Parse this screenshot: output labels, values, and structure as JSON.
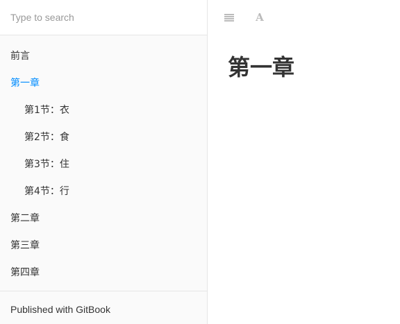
{
  "search": {
    "placeholder": "Type to search"
  },
  "sidebar": {
    "items": [
      {
        "label": "前言",
        "level": 1,
        "active": false
      },
      {
        "label": "第一章",
        "level": 1,
        "active": true
      },
      {
        "label": "第1节：衣",
        "level": 2,
        "active": false
      },
      {
        "label": "第2节：食",
        "level": 2,
        "active": false
      },
      {
        "label": "第3节：住",
        "level": 2,
        "active": false
      },
      {
        "label": "第4节：行",
        "level": 2,
        "active": false
      },
      {
        "label": "第二章",
        "level": 1,
        "active": false
      },
      {
        "label": "第三章",
        "level": 1,
        "active": false
      },
      {
        "label": "第四章",
        "level": 1,
        "active": false
      }
    ],
    "published_label": "Published with GitBook"
  },
  "toolbar": {
    "menu_icon": "hamburger-menu-icon",
    "font_icon": "font-settings-icon",
    "font_glyph": "A"
  },
  "content": {
    "title": "第一章"
  },
  "colors": {
    "active_link": "#008cff",
    "text": "#333333",
    "sidebar_bg": "#fafafa",
    "border": "#e5e5e5"
  }
}
